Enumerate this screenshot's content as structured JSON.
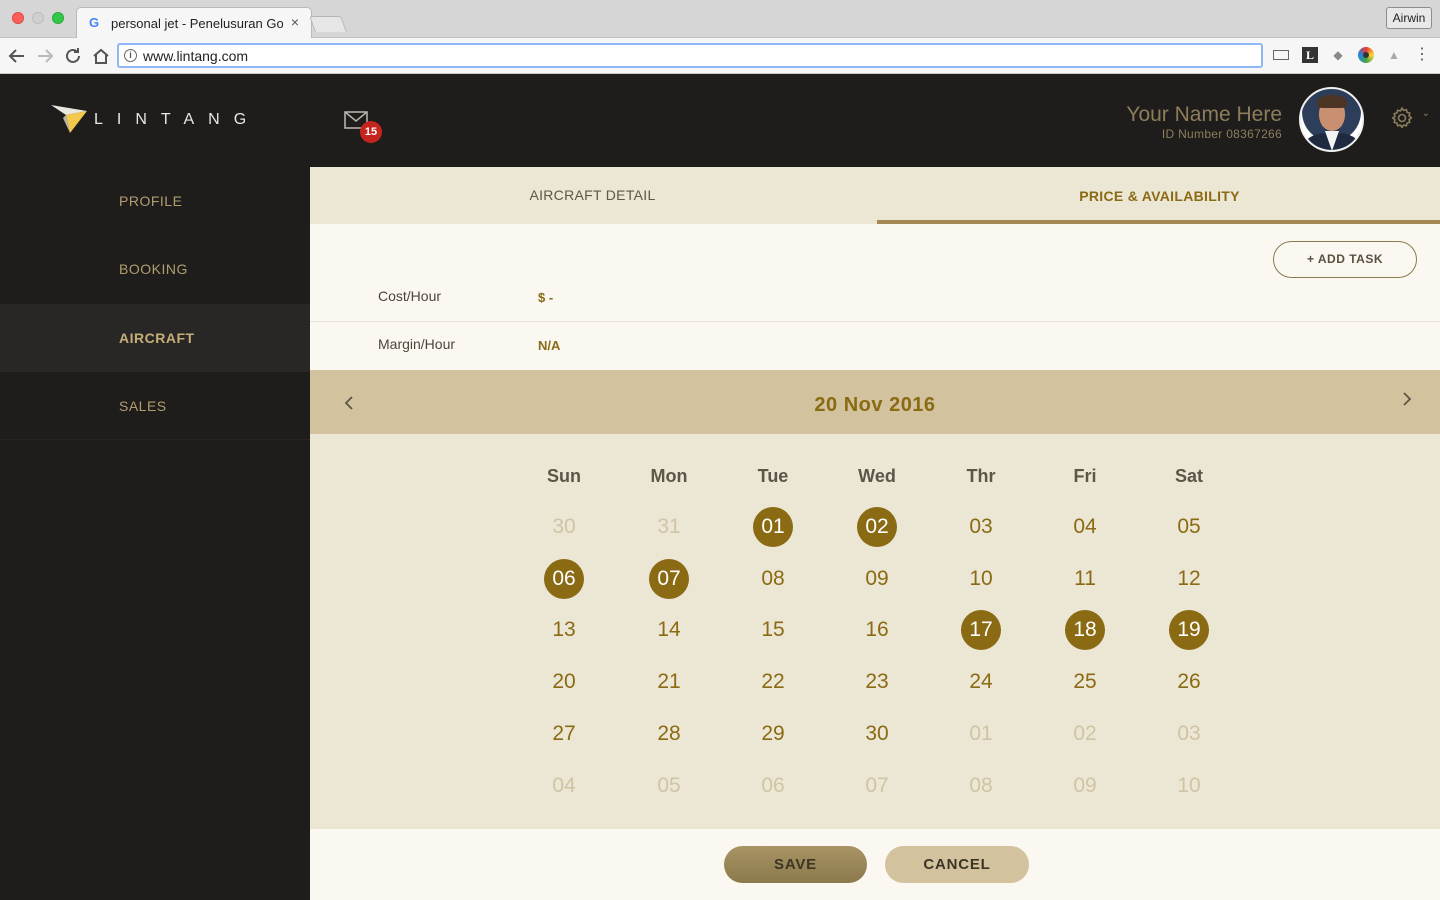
{
  "browser": {
    "tab_title": "personal jet - Penelusuran Goo",
    "tab_close": "×",
    "profile_label": "Airwin",
    "url": "www.lintang.com",
    "icons": [
      "back-icon",
      "forward-icon",
      "reload-icon",
      "home-icon",
      "info-icon",
      "cast-icon",
      "l-extension-icon",
      "dropbox-icon",
      "color-extension-icon",
      "drive-icon",
      "menu-icon"
    ]
  },
  "brand": {
    "logo_text": "LINTANG"
  },
  "sidebar": {
    "items": [
      {
        "label": "PROFILE"
      },
      {
        "label": "BOOKING"
      },
      {
        "label": "AIRCRAFT",
        "active": true
      },
      {
        "label": "SALES"
      }
    ]
  },
  "header": {
    "mail_count": "15",
    "user_name": "Your Name Here",
    "user_id": "ID Number 08367266",
    "settings_caret": "⌄"
  },
  "tabs": [
    {
      "label": "AIRCRAFT DETAIL"
    },
    {
      "label": "PRICE & AVAILABILITY",
      "active": true
    }
  ],
  "actions": {
    "add_task": "+ ADD TASK"
  },
  "fields": {
    "cost_label": "Cost/Hour",
    "cost_value": "$ -",
    "margin_label": "Margin/Hour",
    "margin_value": "N/A"
  },
  "calendar": {
    "title": "20 Nov 2016",
    "weekdays": [
      "Sun",
      "Mon",
      "Tue",
      "Wed",
      "Thr",
      "Fri",
      "Sat"
    ],
    "weeks": [
      [
        {
          "d": "30",
          "m": true
        },
        {
          "d": "31",
          "m": true
        },
        {
          "d": "01",
          "s": true
        },
        {
          "d": "02",
          "s": true
        },
        {
          "d": "03"
        },
        {
          "d": "04"
        },
        {
          "d": "05"
        }
      ],
      [
        {
          "d": "06",
          "s": true
        },
        {
          "d": "07",
          "s": true
        },
        {
          "d": "08"
        },
        {
          "d": "09"
        },
        {
          "d": "10"
        },
        {
          "d": "11"
        },
        {
          "d": "12"
        }
      ],
      [
        {
          "d": "13"
        },
        {
          "d": "14"
        },
        {
          "d": "15"
        },
        {
          "d": "16"
        },
        {
          "d": "17",
          "s": true
        },
        {
          "d": "18",
          "s": true
        },
        {
          "d": "19",
          "s": true
        }
      ],
      [
        {
          "d": "20"
        },
        {
          "d": "21"
        },
        {
          "d": "22"
        },
        {
          "d": "23"
        },
        {
          "d": "24"
        },
        {
          "d": "25"
        },
        {
          "d": "26"
        }
      ],
      [
        {
          "d": "27"
        },
        {
          "d": "28"
        },
        {
          "d": "29"
        },
        {
          "d": "30"
        },
        {
          "d": "01",
          "m": true
        },
        {
          "d": "02",
          "m": true
        },
        {
          "d": "03",
          "m": true
        }
      ],
      [
        {
          "d": "04",
          "m": true
        },
        {
          "d": "05",
          "m": true
        },
        {
          "d": "06",
          "m": true
        },
        {
          "d": "07",
          "m": true
        },
        {
          "d": "08",
          "m": true
        },
        {
          "d": "09",
          "m": true
        },
        {
          "d": "10",
          "m": true
        }
      ]
    ]
  },
  "footer": {
    "save_label": "SAVE",
    "cancel_label": "CANCEL"
  },
  "colors": {
    "accent": "#8a6a12",
    "sidebar_bg": "#1e1d1b",
    "calendar_bg": "#ece6d5",
    "header_band": "#d2c39e",
    "badge": "#c6251f"
  }
}
